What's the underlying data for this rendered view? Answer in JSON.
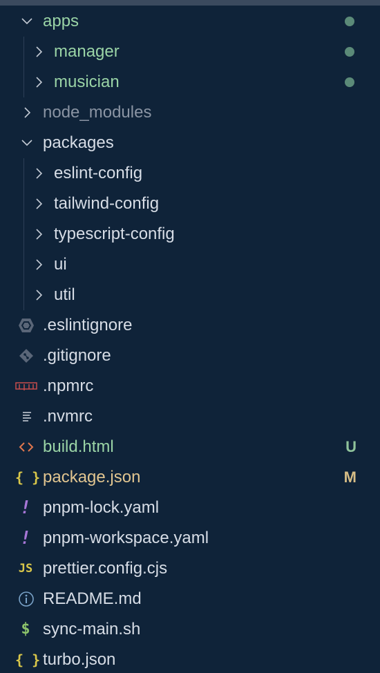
{
  "explorer": {
    "items": [
      {
        "label": "apps",
        "type": "folder",
        "expanded": true,
        "level": 0,
        "status": "dot"
      },
      {
        "label": "manager",
        "type": "folder",
        "expanded": false,
        "level": 1,
        "status": "dot"
      },
      {
        "label": "musician",
        "type": "folder",
        "expanded": false,
        "level": 1,
        "status": "dot"
      },
      {
        "label": "node_modules",
        "type": "folder",
        "expanded": false,
        "level": 0,
        "status": "ignored"
      },
      {
        "label": "packages",
        "type": "folder",
        "expanded": true,
        "level": 0
      },
      {
        "label": "eslint-config",
        "type": "folder",
        "expanded": false,
        "level": 1
      },
      {
        "label": "tailwind-config",
        "type": "folder",
        "expanded": false,
        "level": 1
      },
      {
        "label": "typescript-config",
        "type": "folder",
        "expanded": false,
        "level": 1
      },
      {
        "label": "ui",
        "type": "folder",
        "expanded": false,
        "level": 1
      },
      {
        "label": "util",
        "type": "folder",
        "expanded": false,
        "level": 1
      },
      {
        "label": ".eslintignore",
        "type": "file",
        "icon": "eslint-icon"
      },
      {
        "label": ".gitignore",
        "type": "file",
        "icon": "git-icon"
      },
      {
        "label": ".npmrc",
        "type": "file",
        "icon": "npm-icon"
      },
      {
        "label": ".nvmrc",
        "type": "file",
        "icon": "text-lines-icon"
      },
      {
        "label": "build.html",
        "type": "file",
        "icon": "html-icon",
        "badge": "U"
      },
      {
        "label": "package.json",
        "type": "file",
        "icon": "json-icon",
        "badge": "M"
      },
      {
        "label": "pnpm-lock.yaml",
        "type": "file",
        "icon": "yaml-icon"
      },
      {
        "label": "pnpm-workspace.yaml",
        "type": "file",
        "icon": "yaml-icon"
      },
      {
        "label": "prettier.config.cjs",
        "type": "file",
        "icon": "js-icon",
        "icon_text": "JS"
      },
      {
        "label": "README.md",
        "type": "file",
        "icon": "info-icon"
      },
      {
        "label": "sync-main.sh",
        "type": "file",
        "icon": "shell-icon",
        "icon_text": "$"
      },
      {
        "label": "turbo.json",
        "type": "file",
        "icon": "json-icon"
      }
    ]
  },
  "icon_glyphs": {
    "json": "{ }",
    "yaml": "!",
    "js": "JS",
    "shell": "$"
  },
  "colors": {
    "background": "#0f2339",
    "untracked_green": "#9ad4a6",
    "modified_gold": "#e1c590",
    "ignored_gray": "#8a94a3",
    "status_dot": "#5b8a78"
  }
}
